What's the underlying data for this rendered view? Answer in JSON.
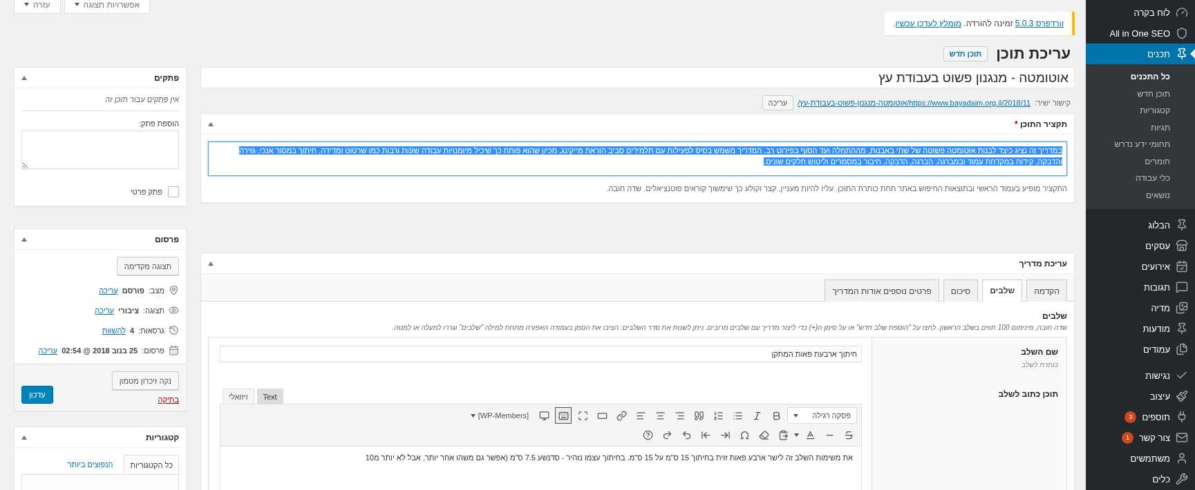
{
  "screen_options": [
    {
      "label": "אפשרויות תצוגה"
    },
    {
      "label": "עזרה"
    }
  ],
  "notice": {
    "parts": [
      {
        "kind": "link",
        "text": "וורדפרס 5.0.3"
      },
      {
        "kind": "text",
        "text": " זמינה להורדה. "
      },
      {
        "kind": "link",
        "text": "מומלץ לעדכן עכשיו"
      },
      {
        "kind": "text",
        "text": "."
      }
    ]
  },
  "heading": {
    "title": "עריכת תוכן",
    "button": "תוכן חדש"
  },
  "post_title": "אוטומטה - מנגנון פשוט בעבודת עץ",
  "permalink": {
    "label": "קישור ישיר:",
    "url": "https://www.bayadaim.org.il/2018/11/אוטומטה-מנגנון-פשוט-בעבודת-עץ/",
    "button": "עריכה"
  },
  "excerpt": {
    "title": "תקציר התוכן",
    "required_mark": "*",
    "highlighted": true,
    "text": "במדריך זה נציג כיצד לבנות אוטומטה פשוטה של שתי באבנות, מההתחלה ועד הסוף בפירוט רב. המדריך משמש בסיס לפעילות עם תלמידים סביב הוראת מייקינג, מכיון שהוא פותח כך שיכיל מיומנויות עבודה שונות ורבות כמו שרטוט ומדידה, חיתוך במסור אנכי, גזירה והדבקה, קידוח במקדחת עמוד ובמברגה, הברגה, הדבקה, חיבור במסמרים וליטוש חלקים שונים.",
    "description": "התקציר מופיע בעמוד הראשי ובתוצאות החיפוש באתר תחת כותרת התוכן. עליו להיות מעניין, קצר וקולע כך שימשוך קוראים פוטנציאלים. שדה חובה."
  },
  "guide_editor": {
    "title": "עריכת מדריך",
    "tabs": [
      {
        "label": "הקדמה",
        "selected": false
      },
      {
        "label": "שלבים",
        "selected": true
      },
      {
        "label": "סיכום",
        "selected": false
      },
      {
        "label": "פרטים נוספים אודות המדריך",
        "selected": false
      }
    ],
    "section_title": "שלבים",
    "section_description": "שדה חובה, מינימום 100 תווים בשלב הראשון. לחצו על \"הוספת שלב חדש\" או על סימן ה(+) כדי ליצור מדריך עם שלבים מרובים. ניתן לשנות את סדר השלבים: הציבו את הסמן בעמודה האפורה מתחת למילה \"שלבים\" וגררו למעלה או למטה.",
    "step_name_label": "שם השלב",
    "step_name_hint": "כותרת לשלב",
    "step_name_value": "חיתוך ארבעת פאות המתקן",
    "content_label": "תוכן כתוב לשלב",
    "editor_tabs": [
      {
        "label": "Text",
        "selected": false
      },
      {
        "label": "ויזואלי",
        "selected": true
      }
    ],
    "format": "פסקה רגילה",
    "shortcodes": "[WP-Members]",
    "toolbar_toggle_on": true,
    "content_text": "את משימות השלב זה לישר ארבע פאות זוית בחיתוך 15 ס\"מ על 15 ס\"מ. בחיתוך עצמו נזהיר - סדנשע 7.5 ס\"מ (אפשר גם משהו אחר יותר, אבל לא יותר מ10"
  },
  "notes": {
    "title": "פתקים",
    "empty": "אין פתקים עבור תוכן זה",
    "add_label": "הוספת פתק:",
    "private_label": "פתק פרטי",
    "private_checked": false
  },
  "publish": {
    "title": "פרסום",
    "preview": "תצוגה מקדימה",
    "rows": [
      {
        "kind": "status",
        "label": "מצב:",
        "value": "פורסם",
        "link": "עריכה"
      },
      {
        "kind": "visibility",
        "label": "תצוגה:",
        "value": "ציבורי",
        "link": "עריכה"
      },
      {
        "kind": "revisions",
        "label": "גרסאות:",
        "value": "4",
        "link": "להשוות"
      },
      {
        "kind": "date",
        "label": "פרסום:",
        "value": "25 בנוב 2018 @ 02:54",
        "link": "עריכה"
      }
    ],
    "cache_button": "נקה זיכרון מטמון",
    "trash": "בתיקה",
    "update": "עדכון"
  },
  "categories": {
    "title": "קטגוריות",
    "tabs": [
      {
        "label": "כל הקטגוריות",
        "selected": true
      },
      {
        "label": "הנפוצים ביותר",
        "selected": false
      }
    ]
  },
  "admin_menu": [
    {
      "kind": "dashboard",
      "label": "לוח בקרה",
      "selected": false
    },
    {
      "kind": "seo",
      "label": "All in One SEO",
      "selected": false
    },
    {
      "kind": "posts",
      "label": "תכנים",
      "selected": true,
      "children": [
        {
          "label": "כל התכנים",
          "selected": true
        },
        {
          "label": "תוכן חדש",
          "selected": false
        },
        {
          "label": "קטגוריות",
          "selected": false
        },
        {
          "label": "תגיות",
          "selected": false
        },
        {
          "label": "תחומי ידע נדרש",
          "selected": false
        },
        {
          "label": "חומרים",
          "selected": false
        },
        {
          "label": "כלי עבודה",
          "selected": false
        },
        {
          "label": "נושאים",
          "selected": false
        }
      ]
    },
    {
      "kind": "pin",
      "label": "הבלוג",
      "selected": false
    },
    {
      "kind": "store",
      "label": "עסקים",
      "selected": false
    },
    {
      "kind": "events",
      "label": "אירועים",
      "selected": false
    },
    {
      "kind": "comments",
      "label": "תגובות",
      "selected": false
    },
    {
      "kind": "media",
      "label": "מדיה",
      "selected": false
    },
    {
      "kind": "pin",
      "label": "מודעות",
      "selected": false
    },
    {
      "kind": "pages",
      "label": "עמודים",
      "selected": false
    },
    {
      "kind": "access",
      "label": "נגישות",
      "selected": false
    },
    {
      "kind": "appearance",
      "label": "עיצוב",
      "selected": false
    },
    {
      "kind": "plugins",
      "label": "תוספים",
      "selected": false,
      "badge": "3"
    },
    {
      "kind": "mail",
      "label": "צור קשר",
      "selected": false,
      "badge": "1"
    },
    {
      "kind": "users",
      "label": "משתמשים",
      "selected": false
    },
    {
      "kind": "tools",
      "label": "כלים",
      "selected": false
    }
  ]
}
